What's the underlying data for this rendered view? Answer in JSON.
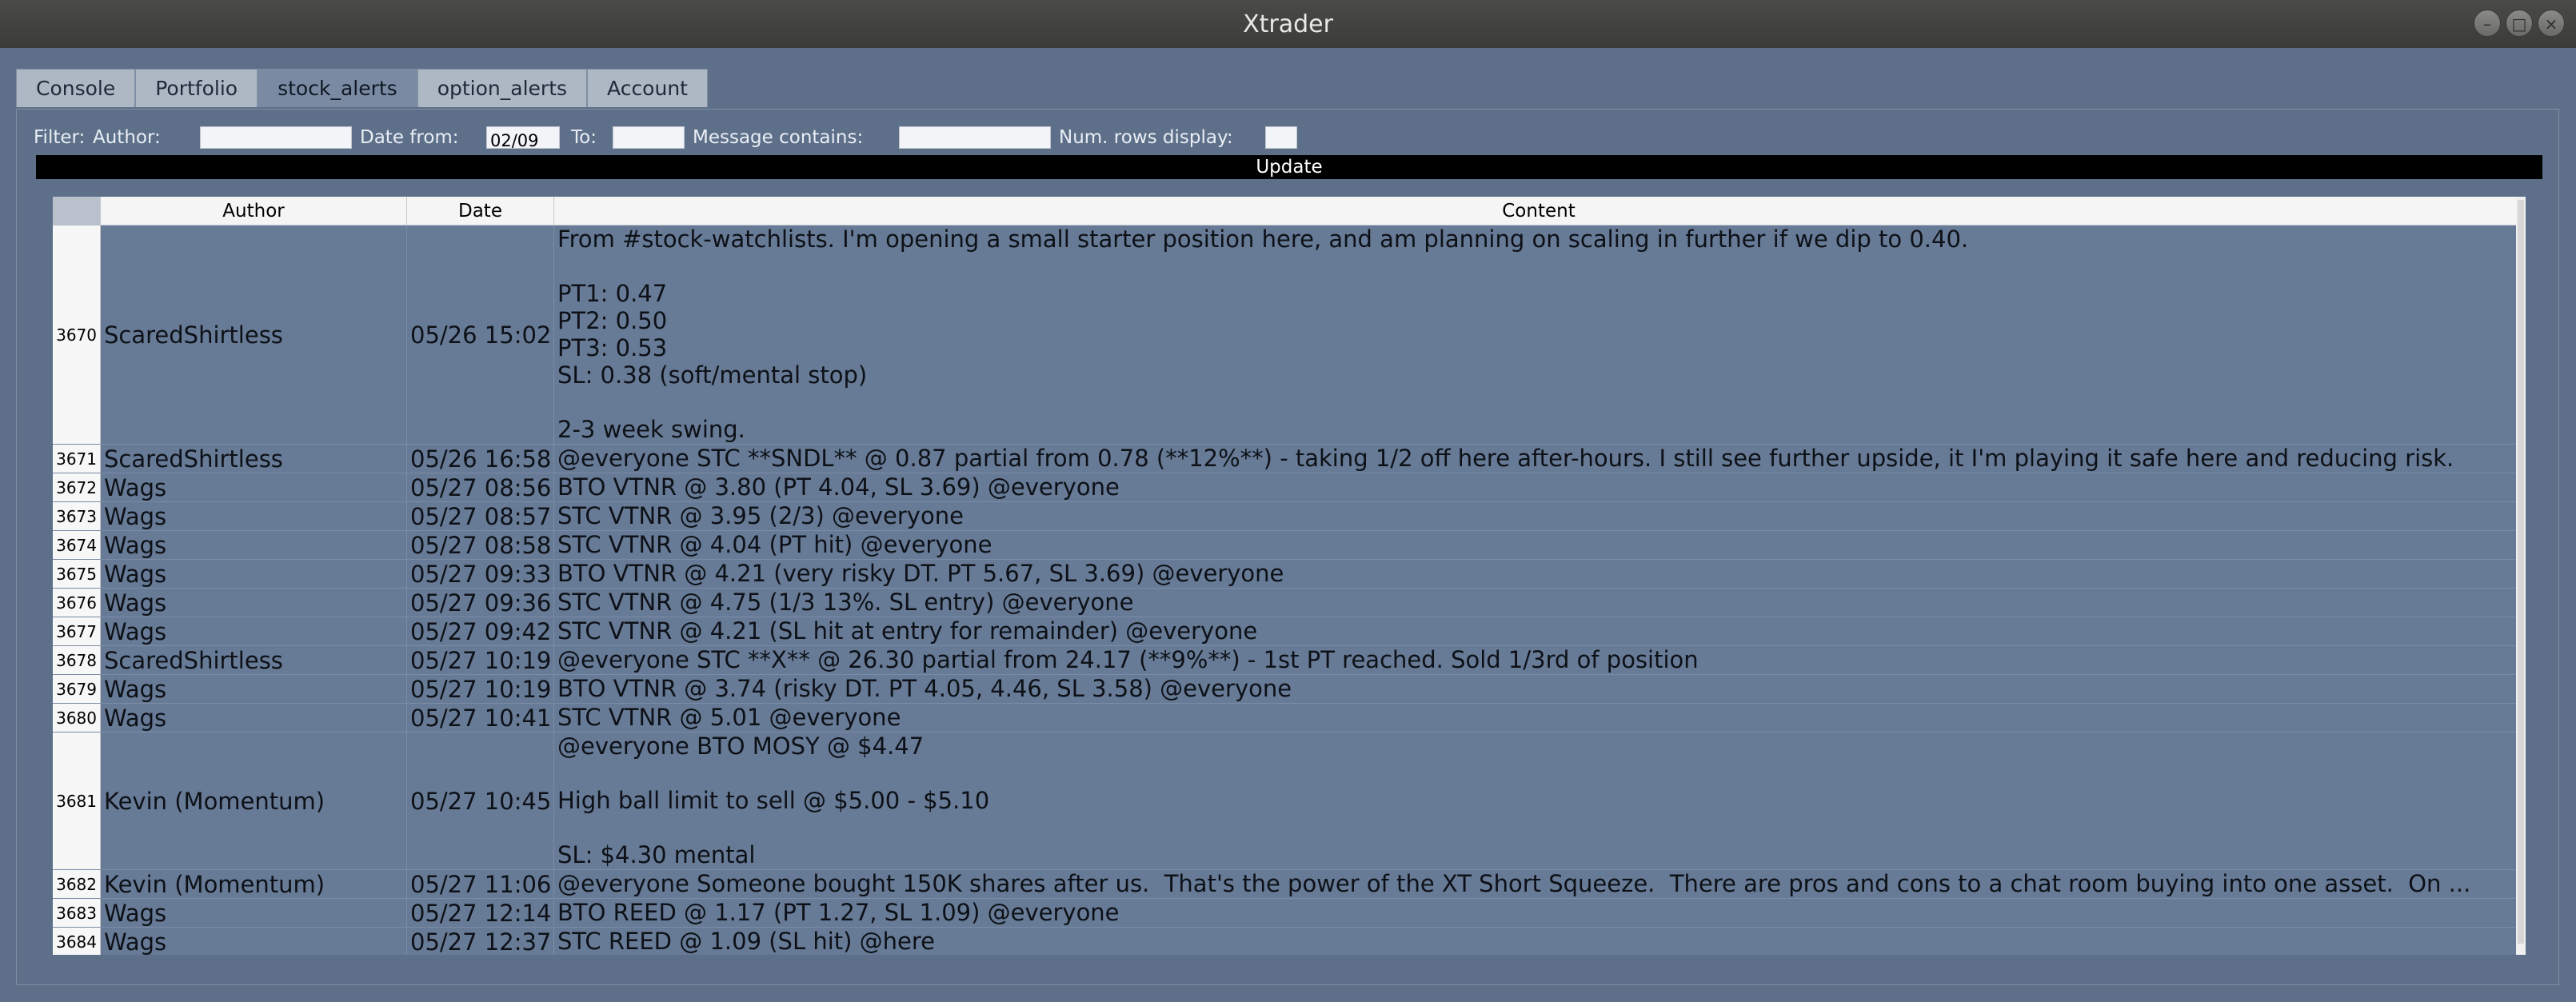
{
  "window": {
    "title": "Xtrader"
  },
  "tabs": [
    {
      "label": "Console"
    },
    {
      "label": "Portfolio"
    },
    {
      "label": "stock_alerts"
    },
    {
      "label": "option_alerts"
    },
    {
      "label": "Account"
    }
  ],
  "filter": {
    "label": "Filter:",
    "author_label": "Author:",
    "author_value": "",
    "date_from_label": "Date from:",
    "date_from_value": "02/09",
    "to_label": "To:",
    "to_value": "",
    "message_label": "Message contains:",
    "message_value": "",
    "num_rows_label": "Num. rows display:",
    "num_rows_value": ""
  },
  "update_label": "Update",
  "table": {
    "columns": [
      "Author",
      "Date",
      "Content"
    ],
    "rows": [
      {
        "index": "3670",
        "author": "ScaredShirtless",
        "date": "05/26 15:02",
        "content": "From #stock-watchlists. I'm opening a small starter position here, and am planning on scaling in further if we dip to 0.40.\n\nPT1: 0.47\nPT2: 0.50\nPT3: 0.53\nSL: 0.38 (soft/mental stop)\n\n2-3 week swing."
      },
      {
        "index": "3671",
        "author": "ScaredShirtless",
        "date": "05/26 16:58",
        "content": "@everyone STC **SNDL** @ 0.87 partial from 0.78 (**12%**) - taking 1/2 off here after-hours. I still see further upside, it I'm playing it safe here and reducing risk."
      },
      {
        "index": "3672",
        "author": "Wags",
        "date": "05/27 08:56",
        "content": "BTO VTNR @ 3.80 (PT 4.04, SL 3.69) @everyone"
      },
      {
        "index": "3673",
        "author": "Wags",
        "date": "05/27 08:57",
        "content": "STC VTNR @ 3.95 (2/3) @everyone"
      },
      {
        "index": "3674",
        "author": "Wags",
        "date": "05/27 08:58",
        "content": "STC VTNR @ 4.04 (PT hit) @everyone"
      },
      {
        "index": "3675",
        "author": "Wags",
        "date": "05/27 09:33",
        "content": "BTO VTNR @ 4.21 (very risky DT. PT 5.67, SL 3.69) @everyone"
      },
      {
        "index": "3676",
        "author": "Wags",
        "date": "05/27 09:36",
        "content": "STC VTNR @ 4.75 (1/3 13%. SL entry) @everyone"
      },
      {
        "index": "3677",
        "author": "Wags",
        "date": "05/27 09:42",
        "content": "STC VTNR @ 4.21 (SL hit at entry for remainder) @everyone"
      },
      {
        "index": "3678",
        "author": "ScaredShirtless",
        "date": "05/27 10:19",
        "content": "@everyone STC **X** @ 26.30 partial from 24.17 (**9%**) - 1st PT reached. Sold 1/3rd of position"
      },
      {
        "index": "3679",
        "author": "Wags",
        "date": "05/27 10:19",
        "content": "BTO VTNR @ 3.74 (risky DT. PT 4.05, 4.46, SL 3.58) @everyone"
      },
      {
        "index": "3680",
        "author": "Wags",
        "date": "05/27 10:41",
        "content": "STC VTNR @ 5.01 @everyone"
      },
      {
        "index": "3681",
        "author": "Kevin (Momentum)",
        "date": "05/27 10:45",
        "content": "@everyone BTO MOSY @ $4.47\n\nHigh ball limit to sell @ $5.00 - $5.10\n\nSL: $4.30 mental"
      },
      {
        "index": "3682",
        "author": "Kevin (Momentum)",
        "date": "05/27 11:06",
        "content": "@everyone Someone bought 150K shares after us.  That's the power of the XT Short Squeeze.  There are pros and cons to a chat room buying into one asset.  On ..."
      },
      {
        "index": "3683",
        "author": "Wags",
        "date": "05/27 12:14",
        "content": "BTO REED @ 1.17 (PT 1.27, SL 1.09) @everyone"
      },
      {
        "index": "3684",
        "author": "Wags",
        "date": "05/27 12:37",
        "content": "STC REED @ 1.09 (SL hit) @here"
      }
    ]
  },
  "icons": {
    "minimize": "minimize-icon",
    "maximize": "maximize-icon",
    "close": "close-icon"
  }
}
